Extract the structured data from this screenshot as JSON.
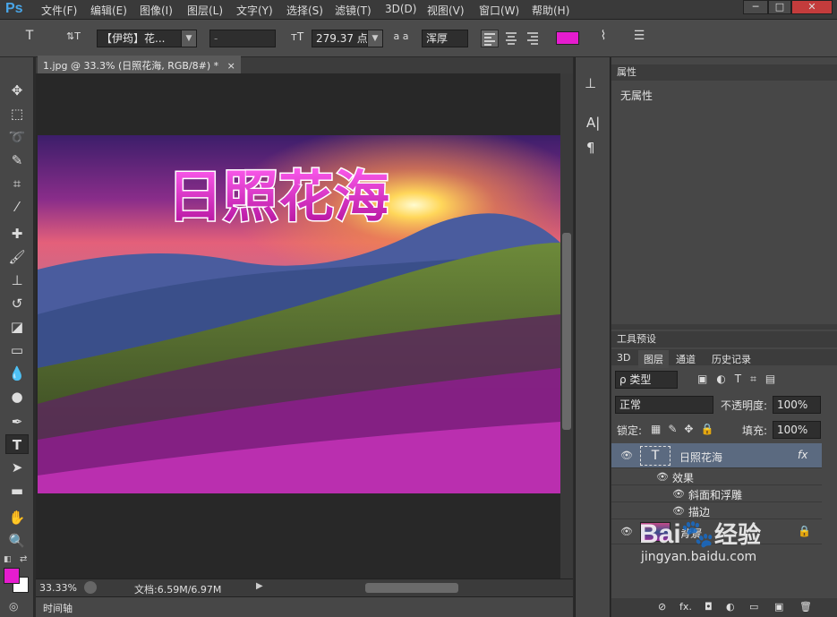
{
  "app": {
    "logo": "Ps",
    "window_controls": [
      "─",
      "□",
      "✕"
    ]
  },
  "menus": [
    "文件(F)",
    "编辑(E)",
    "图像(I)",
    "图层(L)",
    "文字(Y)",
    "选择(S)",
    "滤镜(T)",
    "3D(D)",
    "视图(V)",
    "窗口(W)",
    "帮助(H)"
  ],
  "options": {
    "tool_glyph": "T",
    "orient_glyph": "⇅T",
    "font_family": "【伊筠】花...",
    "font_style": "-",
    "size_glyph": "тT",
    "font_size": "279.37 点",
    "aa_glyph": "a a",
    "antialias": "浑厚",
    "text_color": "#e61ccf",
    "warp_glyph": "⌇",
    "panels_glyph": "☰"
  },
  "document": {
    "tab": "1.jpg @ 33.3% (日照花海, RGB/8#) *",
    "close": "×",
    "text": "日照花海"
  },
  "status": {
    "zoom": "33.33%",
    "doc_info": "文档:6.59M/6.97M"
  },
  "timeline": {
    "label": "时间轴"
  },
  "properties": {
    "title": "属性",
    "value": "无属性"
  },
  "tool_presets": {
    "title": "工具预设"
  },
  "layers_panel": {
    "tabs": [
      "3D",
      "图层",
      "通道",
      "历史记录"
    ],
    "filter_label": "ρ 类型",
    "blend_mode": "正常",
    "opacity_label": "不透明度:",
    "opacity": "100%",
    "lock_label": "锁定:",
    "fill_label": "填充:",
    "fill": "100%",
    "layers": [
      {
        "name": "日照花海",
        "fx": "fx"
      },
      {
        "name": "效果"
      },
      {
        "name": "斜面和浮雕"
      },
      {
        "name": "描边"
      },
      {
        "name": "背景"
      }
    ],
    "footer_icons": [
      "⊘",
      "fx.",
      "◘",
      "◐",
      "▭",
      "▣",
      "🗑"
    ]
  },
  "watermark": {
    "brand": "Bai",
    "brand2": "经验",
    "url": "jingyan.baidu.com"
  },
  "colors": {
    "foreground": "#e61ccf",
    "background": "#ffffff"
  }
}
